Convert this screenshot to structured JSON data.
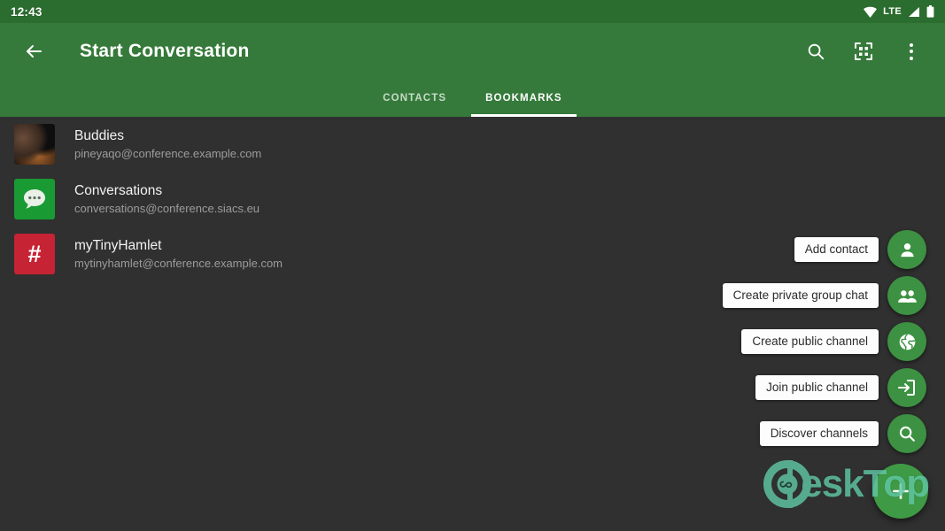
{
  "statusbar": {
    "clock": "12:43",
    "network_label": "LTE",
    "icons": [
      "wifi-icon",
      "signal-icon",
      "battery-icon"
    ]
  },
  "appbar": {
    "back_icon": "back-arrow-icon",
    "title": "Start Conversation",
    "actions": [
      {
        "name": "search-icon",
        "label": "Search"
      },
      {
        "name": "qr-scan-icon",
        "label": "Scan QR code"
      },
      {
        "name": "overflow-menu-icon",
        "label": "More options"
      }
    ]
  },
  "tabs": [
    {
      "label": "CONTACTS",
      "active": false
    },
    {
      "label": "BOOKMARKS",
      "active": true
    }
  ],
  "list": {
    "items": [
      {
        "title": "Buddies",
        "subtitle": "pineyaqo@conference.example.com",
        "avatar_type": "photo",
        "avatar_glyph": ""
      },
      {
        "title": "Conversations",
        "subtitle": "conversations@conference.siacs.eu",
        "avatar_type": "conv",
        "avatar_glyph": ""
      },
      {
        "title": "myTinyHamlet",
        "subtitle": "mytinyhamlet@conference.example.com",
        "avatar_type": "hash",
        "avatar_glyph": "#"
      }
    ]
  },
  "speed_dial": {
    "actions": [
      {
        "label": "Add contact",
        "icon": "person-add-icon"
      },
      {
        "label": "Create private group chat",
        "icon": "group-icon"
      },
      {
        "label": "Create public channel",
        "icon": "globe-icon"
      },
      {
        "label": "Join public channel",
        "icon": "login-icon"
      },
      {
        "label": "Discover channels",
        "icon": "search-icon"
      }
    ],
    "main_fab_icon": "add-icon"
  },
  "watermark": {
    "text": "eskTop",
    "mark": "desktop-logo-icon"
  },
  "colors": {
    "appbar_green": "#357a3a",
    "statusbar_green": "#2b6d2f",
    "background": "#303030",
    "fab_green": "#3c9242",
    "avatar_red": "#c62334",
    "avatar_green": "#199a33",
    "watermark_teal": "#5fc6a4"
  }
}
